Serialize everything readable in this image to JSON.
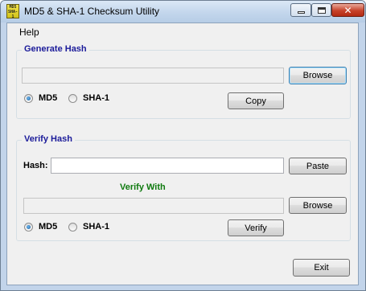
{
  "window": {
    "title": "MD5 & SHA-1 Checksum Utility",
    "icon_text": "MD5 SHA-1"
  },
  "menu": {
    "items": [
      "Help"
    ]
  },
  "generate": {
    "title": "Generate Hash",
    "path_value": "",
    "browse_label": "Browse",
    "copy_label": "Copy",
    "radio_md5": "MD5",
    "radio_sha1": "SHA-1",
    "selected": "MD5"
  },
  "verify": {
    "title": "Verify Hash",
    "hash_label": "Hash:",
    "hash_value": "",
    "paste_label": "Paste",
    "verify_with_label": "Verify With",
    "path_value": "",
    "browse_label": "Browse",
    "verify_label": "Verify",
    "radio_md5": "MD5",
    "radio_sha1": "SHA-1",
    "selected": "MD5"
  },
  "footer": {
    "exit_label": "Exit"
  },
  "colors": {
    "group_title": "#1b1b9a",
    "verify_with": "#0f7a0f",
    "close_button": "#c7432b"
  }
}
